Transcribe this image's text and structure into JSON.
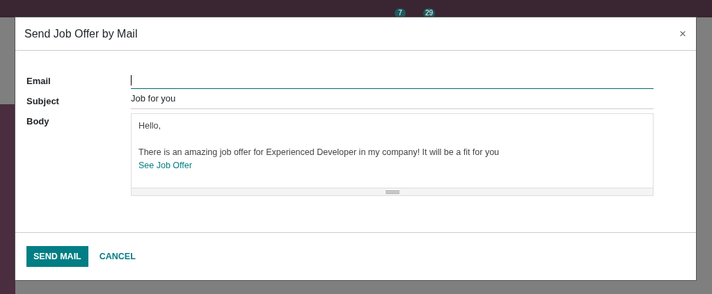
{
  "navbar": {
    "badges": [
      "7",
      "29"
    ]
  },
  "dialog": {
    "title": "Send Job Offer by Mail",
    "close": "×",
    "fields": [
      {
        "label": "Email",
        "kind": "input",
        "focused": true
      },
      {
        "label": "Subject",
        "kind": "input",
        "focused": false,
        "value": "Job for you"
      },
      {
        "label": "Body",
        "kind": "html",
        "paragraphs": [
          {
            "kind": "text",
            "text": "Hello,"
          },
          {
            "kind": "blank"
          },
          {
            "kind": "text",
            "text": "There is an amazing job offer for Experienced Developer in my company! It will be a fit for you"
          },
          {
            "kind": "link",
            "text": "See Job Offer"
          }
        ]
      }
    ],
    "buttons": [
      {
        "label": "SEND MAIL",
        "kind": "primary"
      },
      {
        "label": "CANCEL",
        "kind": "link"
      }
    ]
  }
}
